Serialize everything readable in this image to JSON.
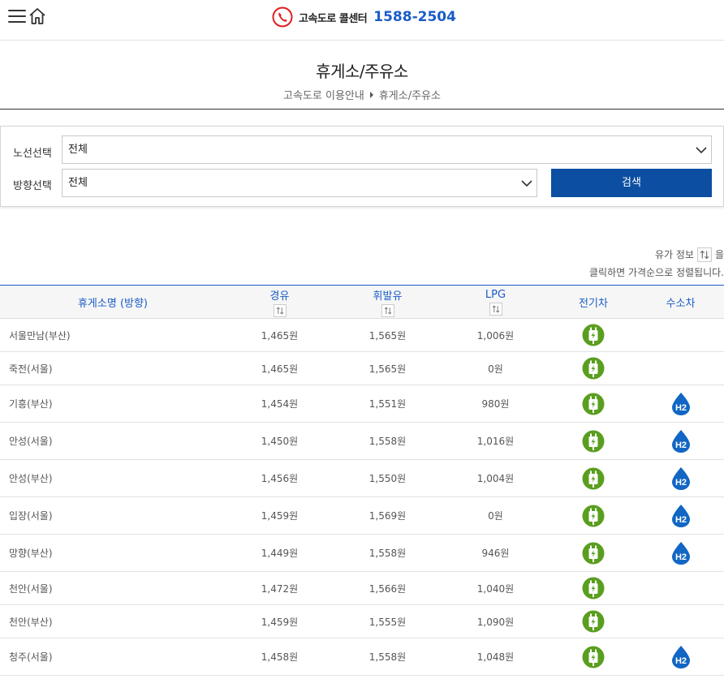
{
  "header": {
    "callcenter_label": "고속도로 콜센터",
    "callcenter_number": "1588-2504",
    "brand_red": "#e11d1d",
    "brand_blue": "#1a5cc8"
  },
  "page": {
    "title": "휴게소/주유소",
    "breadcrumb": [
      "고속도로 이용안내",
      "휴게소/주유소"
    ]
  },
  "filter": {
    "route_label": "노선선택",
    "route_value": "전체",
    "direction_label": "방향선택",
    "direction_value": "전체",
    "search_label": "검색"
  },
  "sort_info": {
    "line1_prefix": "유가 정보",
    "line1_suffix": "을",
    "line2": "클릭하면 가격순으로 정렬됩니다."
  },
  "table": {
    "headers": {
      "name": "휴게소명 (방향)",
      "diesel": "경유",
      "gasoline": "휘발유",
      "lpg": "LPG",
      "ev": "전기차",
      "hydrogen": "수소차"
    },
    "rows": [
      {
        "name": "서울만남(부산)",
        "diesel": "1,465원",
        "gasoline": "1,565원",
        "lpg": "1,006원",
        "ev": true,
        "h2": false
      },
      {
        "name": "죽전(서울)",
        "diesel": "1,465원",
        "gasoline": "1,565원",
        "lpg": "0원",
        "ev": true,
        "h2": false
      },
      {
        "name": "기흥(부산)",
        "diesel": "1,454원",
        "gasoline": "1,551원",
        "lpg": "980원",
        "ev": true,
        "h2": true
      },
      {
        "name": "안성(서울)",
        "diesel": "1,450원",
        "gasoline": "1,558원",
        "lpg": "1,016원",
        "ev": true,
        "h2": true
      },
      {
        "name": "안성(부산)",
        "diesel": "1,456원",
        "gasoline": "1,550원",
        "lpg": "1,004원",
        "ev": true,
        "h2": true
      },
      {
        "name": "입장(서울)",
        "diesel": "1,459원",
        "gasoline": "1,569원",
        "lpg": "0원",
        "ev": true,
        "h2": true
      },
      {
        "name": "망향(부산)",
        "diesel": "1,449원",
        "gasoline": "1,558원",
        "lpg": "946원",
        "ev": true,
        "h2": true
      },
      {
        "name": "천안(서울)",
        "diesel": "1,472원",
        "gasoline": "1,566원",
        "lpg": "1,040원",
        "ev": true,
        "h2": false
      },
      {
        "name": "천안(부산)",
        "diesel": "1,459원",
        "gasoline": "1,555원",
        "lpg": "1,090원",
        "ev": true,
        "h2": false
      },
      {
        "name": "청주(서울)",
        "diesel": "1,458원",
        "gasoline": "1,558원",
        "lpg": "1,048원",
        "ev": true,
        "h2": true
      }
    ],
    "ev_icon": "ev-charger-icon",
    "h2_icon": "hydrogen-drop-icon",
    "ev_color": "#5a9e1f",
    "h2_color": "#1266c4",
    "h2_text": "H2"
  }
}
